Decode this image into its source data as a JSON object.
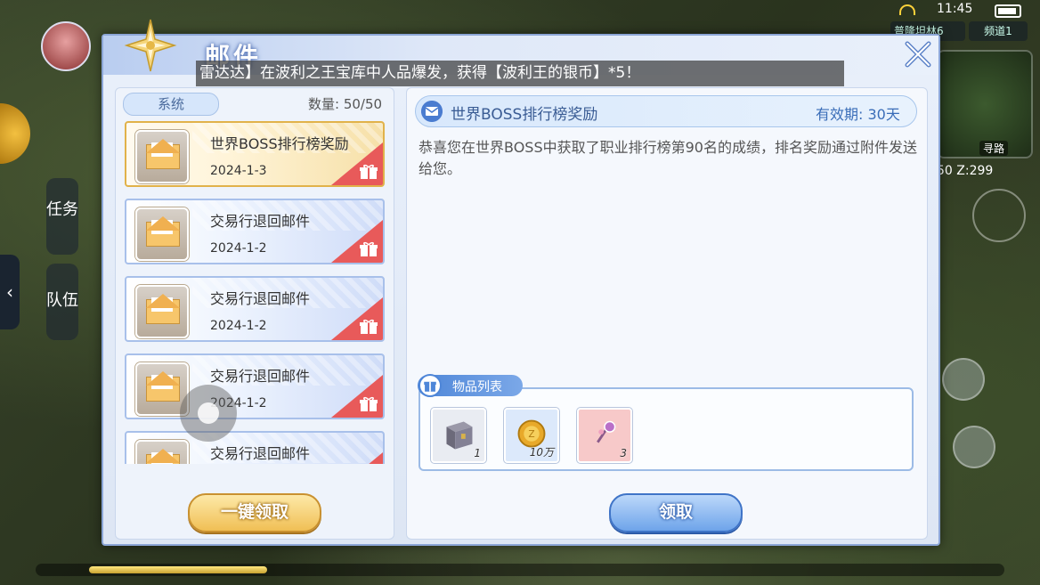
{
  "status_bar": {
    "time": "11:45"
  },
  "hud": {
    "location": "普隆坦林6",
    "channel": "频道1",
    "coords": "50 Z:299",
    "navigate": "寻路",
    "left_tabs": [
      "任务",
      "队伍"
    ]
  },
  "window": {
    "title": "邮件"
  },
  "broadcast": "雷达达】在波利之王宝库中人品爆发，获得【波利王的银币】*5！",
  "mail_list": {
    "tab": "系统",
    "count_label": "数量: 50/50",
    "items": [
      {
        "title": "世界BOSS排行榜奖励",
        "date": "2024-1-3",
        "selected": true
      },
      {
        "title": "交易行退回邮件",
        "date": "2024-1-2",
        "selected": false
      },
      {
        "title": "交易行退回邮件",
        "date": "2024-1-2",
        "selected": false
      },
      {
        "title": "交易行退回邮件",
        "date": "2024-1-2",
        "selected": false
      },
      {
        "title": "交易行退回邮件",
        "date": "",
        "selected": false
      }
    ],
    "claim_all_label": "一键领取"
  },
  "detail": {
    "title": "世界BOSS排行榜奖励",
    "expiry": "有效期: 30天",
    "content": "恭喜您在世界BOSS中获取了职业排行榜第90名的成绩，排名奖励通过附件发送给您。",
    "items_label": "物品列表",
    "items": [
      {
        "icon": "chest-icon",
        "count": "1",
        "bg": "#e9ecf2"
      },
      {
        "icon": "gold-coin-icon",
        "count": "10万",
        "bg": "#dce9fb"
      },
      {
        "icon": "pink-gem-icon",
        "count": "3",
        "bg": "#f7c9c9"
      }
    ],
    "claim_label": "领取"
  },
  "colors": {
    "accent_blue": "#4e86d8",
    "accent_gold": "#f0bf55",
    "gift_red": "#e85a5a"
  }
}
